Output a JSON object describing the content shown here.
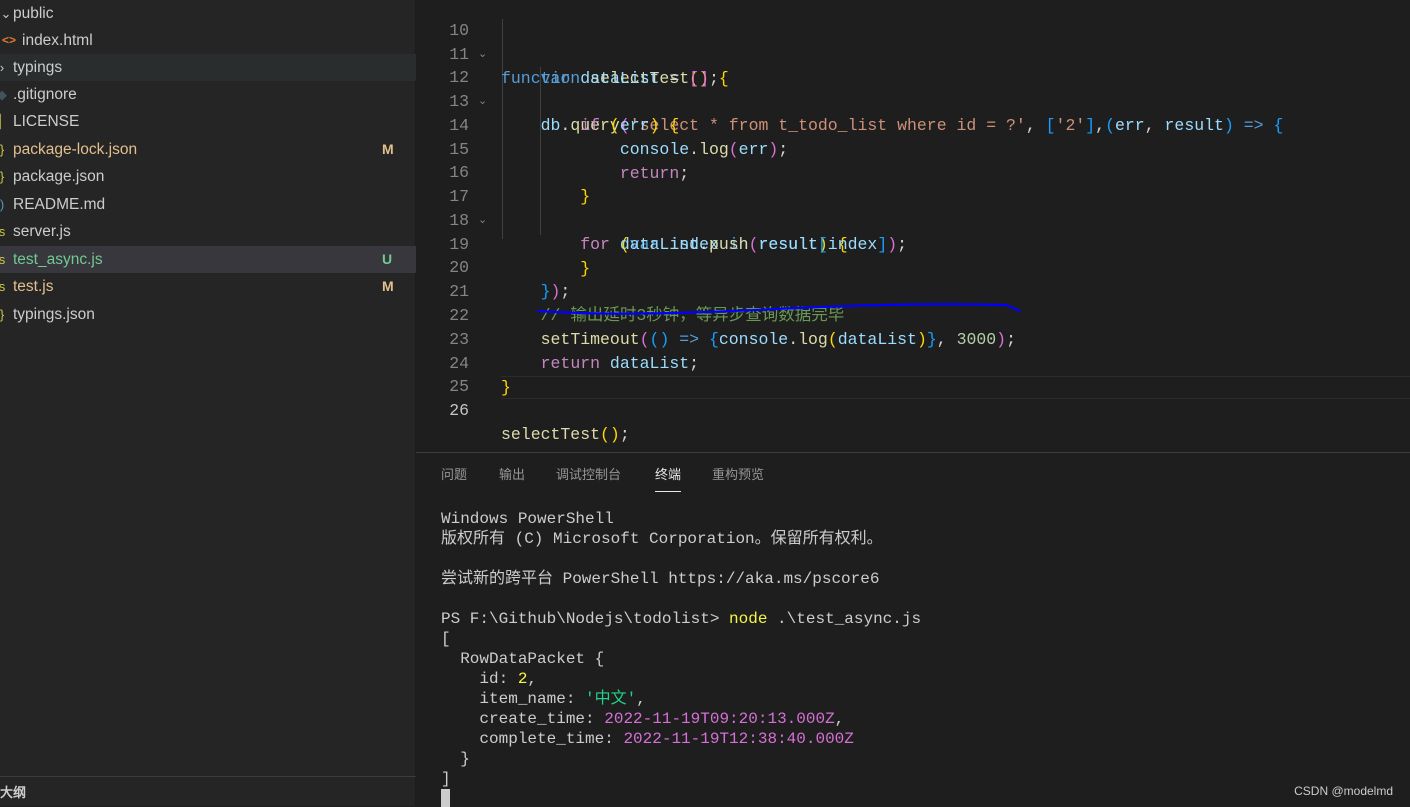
{
  "explorer": {
    "items": [
      {
        "label": "public",
        "badge": ""
      },
      {
        "label": "index.html",
        "badge": ""
      },
      {
        "label": "typings",
        "badge": ""
      },
      {
        "label": ".gitignore",
        "badge": ""
      },
      {
        "label": "LICENSE",
        "badge": ""
      },
      {
        "label": "package-lock.json",
        "badge": "M"
      },
      {
        "label": "package.json",
        "badge": ""
      },
      {
        "label": "README.md",
        "badge": ""
      },
      {
        "label": "server.js",
        "badge": ""
      },
      {
        "label": "test_async.js",
        "badge": "U"
      },
      {
        "label": "test.js",
        "badge": "M"
      },
      {
        "label": "typings.json",
        "badge": ""
      }
    ],
    "icons": {
      "folder_open": "chevron-down-icon",
      "folder_closed": "chevron-right-icon",
      "html": "html-file-icon",
      "json": "json-file-icon",
      "js": "js-file-icon",
      "md": "markdown-file-icon",
      "license": "license-file-icon",
      "gitignore": "gitignore-file-icon"
    },
    "outline_label": "大纲"
  },
  "editor": {
    "line_numbers": [
      "10",
      "11",
      "12",
      "13",
      "14",
      "15",
      "16",
      "17",
      "18",
      "19",
      "20",
      "21",
      "22",
      "23",
      "24",
      "25",
      "26"
    ],
    "active_line": "26",
    "lines": {
      "l10": {
        "kw": "function",
        "name": "selectTest",
        "paren": "()",
        "brace": "{"
      },
      "l11": {
        "kw": "var",
        "name": "dataList",
        "eq": " = ",
        "val": "[]",
        "semi": ";"
      },
      "l12": {
        "obj": "db",
        "dot": ".",
        "fn": "query",
        "open": "(",
        "sql": "'select * from t_todo_list where id = ?'",
        "comma": ", ",
        "arr_open": "[",
        "arr_val": "'2'",
        "arr_close": "]",
        "comma2": ",",
        "p_open": "(",
        "err": "err",
        "comma3": ", ",
        "result": "result",
        "p_close": ")",
        "arrow": " => ",
        "brace": "{"
      },
      "l13": {
        "kw": "if",
        "open": " (",
        "err": "err",
        "close": ") ",
        "brace": "{"
      },
      "l14": {
        "obj": "console",
        "dot": ".",
        "fn": "log",
        "open": "(",
        "arg": "err",
        "close": ")",
        "semi": ";"
      },
      "l15": {
        "kw": "return",
        "semi": ";"
      },
      "l16": {
        "brace": "}"
      },
      "l17": {
        "kw": "for",
        "open": " (",
        "var": "var",
        "index": " index ",
        "in": "in",
        "result": " result",
        "close": ") ",
        "brace": "{"
      },
      "l18": {
        "obj": "dataList",
        "dot": ".",
        "fn": "push",
        "open": "(",
        "arg": "result",
        "sub_open": "[",
        "idx": "index",
        "sub_close": "]",
        "close": ")",
        "semi": ";"
      },
      "l19": {
        "brace": "}"
      },
      "l20": {
        "brace": "}",
        "close": ")",
        "semi": ";"
      },
      "l21": {
        "comment": "// 输出延时3秒钟，等异步查询数据完毕"
      },
      "l22": {
        "fn": "setTimeout",
        "open": "(",
        "p": "()",
        "arrow": " => ",
        "b_open": "{",
        "obj": "console",
        "dot": ".",
        "log": "log",
        "l_open": "(",
        "arg": "dataList",
        "l_close": ")",
        "b_close": "}",
        "comma": ", ",
        "num": "3000",
        "close": ")",
        "semi": ";"
      },
      "l23": {
        "kw": "return",
        "val": " dataList",
        "semi": ";"
      },
      "l24": {
        "brace": "}"
      },
      "l26": {
        "fn": "selectTest",
        "paren": "()",
        "semi": ";"
      }
    },
    "annotation_color": "#0000ff"
  },
  "panel": {
    "tabs": [
      "问题",
      "输出",
      "调试控制台",
      "终端",
      "重构预览"
    ],
    "active_tab": "终端",
    "terminal": {
      "l1": "Windows PowerShell",
      "l2": "版权所有 (C) Microsoft Corporation。保留所有权利。",
      "l4": "尝试新的跨平台 PowerShell https://aka.ms/pscore6",
      "prompt": "PS F:\\Github\\Nodejs\\todolist> ",
      "cmd": "node",
      "cmd_arg": " .\\test_async.js",
      "open_bracket": "[",
      "row": "  RowDataPacket {",
      "id_key": "    id: ",
      "id_val": "2",
      "id_comma": ",",
      "name_key": "    item_name: ",
      "name_val": "'中文'",
      "name_comma": ",",
      "create_key": "    create_time: ",
      "create_val": "2022-11-19T09:20:13.000Z",
      "create_comma": ",",
      "complete_key": "    complete_time: ",
      "complete_val": "2022-11-19T12:38:40.000Z",
      "row_close": "  }",
      "close_bracket": "]"
    }
  },
  "watermark": "CSDN @modelmd"
}
